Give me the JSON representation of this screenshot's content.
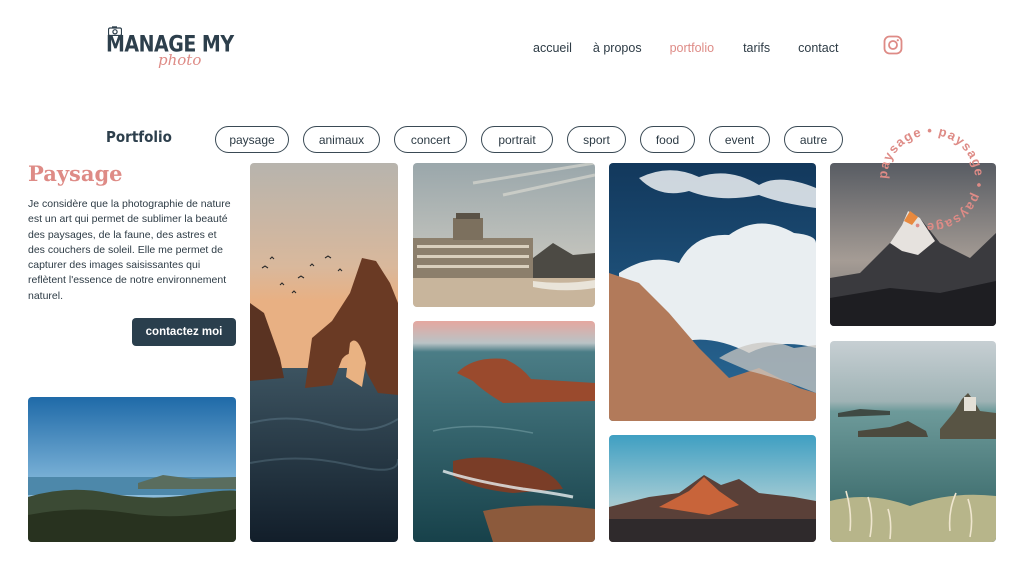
{
  "header": {
    "logo": {
      "main": "MANAGE MY",
      "sub": "photo",
      "camera_icon": "camera-icon"
    },
    "nav": [
      {
        "label": "accueil",
        "active": false
      },
      {
        "label": "à propos",
        "active": false
      },
      {
        "label": "portfolio",
        "active": true
      },
      {
        "label": "tarifs",
        "active": false
      },
      {
        "label": "contact",
        "active": false
      }
    ],
    "social_icon": "instagram-icon"
  },
  "portfolio": {
    "section_title": "Portfolio",
    "filters": [
      "paysage",
      "animaux",
      "concert",
      "portrait",
      "sport",
      "food",
      "event",
      "autre"
    ]
  },
  "category": {
    "title": "Paysage",
    "description": "Je considère que la photographie de nature est un art qui permet de sublimer la beauté des paysages, de la faune, des astres et des couchers de soleil. Elle me permet de capturer des images saisissantes qui reflètent l'essence de notre environnement naturel.",
    "cta_label": "contactez moi",
    "badge_text": "paysage • paysage • paysage • "
  },
  "colors": {
    "accent": "#de8b86",
    "dark": "#2a3f4d",
    "text": "#2d3b45"
  }
}
